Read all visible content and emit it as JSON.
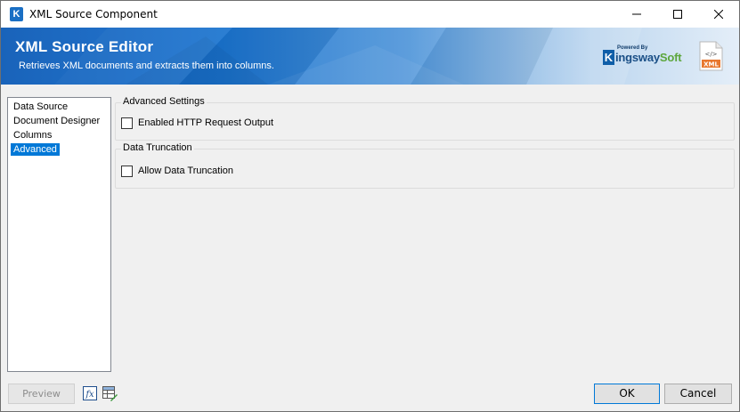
{
  "window": {
    "title": "XML Source Component",
    "icon": "kingswaysoft-k-icon"
  },
  "banner": {
    "title": "XML Source Editor",
    "subtitle": "Retrieves XML documents and extracts them into columns.",
    "brand_powered": "Powered By",
    "brand_k": "K",
    "brand_name_a": "ingsway",
    "brand_name_b": "Soft",
    "file_badge": "XML",
    "file_glyph": "</>"
  },
  "nav": {
    "items": [
      {
        "label": "Data Source",
        "selected": false
      },
      {
        "label": "Document Designer",
        "selected": false
      },
      {
        "label": "Columns",
        "selected": false
      },
      {
        "label": "Advanced",
        "selected": true
      }
    ]
  },
  "advanced_settings": {
    "label": "Advanced Settings",
    "http_output_label": "Enabled HTTP Request Output",
    "http_output_checked": false
  },
  "data_truncation": {
    "label": "Data Truncation",
    "allow_label": "Allow Data Truncation",
    "allow_checked": false
  },
  "footer": {
    "preview_label": "Preview",
    "ok_label": "OK",
    "cancel_label": "Cancel"
  },
  "colors": {
    "accent": "#0078d7",
    "banner_dark": "#0d5bb7",
    "brand_green": "#5ca63c",
    "file_orange": "#e8772e"
  }
}
